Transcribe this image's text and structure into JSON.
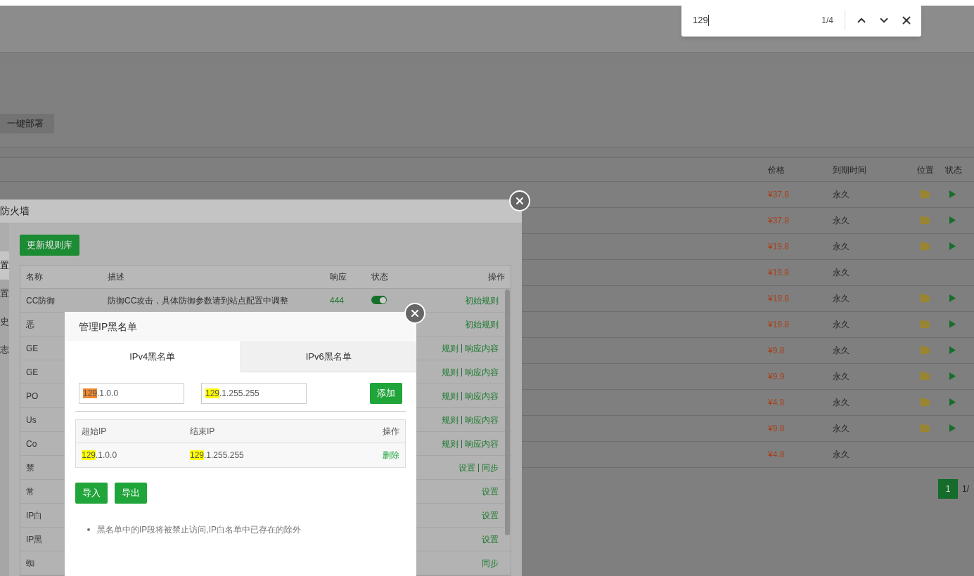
{
  "page": {
    "deploy_button": "一键部署",
    "table": {
      "columns": [
        "价格",
        "到期时间",
        "位置",
        "状态"
      ],
      "rows": [
        {
          "price": "¥37.8",
          "expiry": "永久",
          "folder": true,
          "running": true
        },
        {
          "price": "¥37.8",
          "expiry": "永久",
          "folder": true,
          "running": true
        },
        {
          "price": "¥19.8",
          "expiry": "永久",
          "folder": true,
          "running": true
        },
        {
          "price": "¥19.8",
          "expiry": "永久",
          "folder": false,
          "running": false
        },
        {
          "price": "¥19.8",
          "expiry": "永久",
          "folder": true,
          "running": true
        },
        {
          "price": "¥19.8",
          "expiry": "永久",
          "folder": true,
          "running": true
        },
        {
          "price": "¥9.8",
          "expiry": "永久",
          "folder": true,
          "running": true
        },
        {
          "price": "¥9.9",
          "expiry": "永久",
          "folder": true,
          "running": true
        },
        {
          "price": "¥4.8",
          "expiry": "永久",
          "folder": true,
          "running": true
        },
        {
          "price": "¥9.8",
          "expiry": "永久",
          "folder": true,
          "running": true
        },
        {
          "price": "¥4.8",
          "expiry": "永久",
          "folder": false,
          "running": false
        }
      ]
    },
    "pagination": {
      "pages": [
        {
          "label": "1",
          "selected": true
        }
      ],
      "summary": "1/"
    }
  },
  "firewall_dialog": {
    "title": "防火墙",
    "sidebar": [
      {
        "selected": false
      },
      {
        "label": "置",
        "selected": true
      },
      {
        "label": "置",
        "selected": false
      },
      {
        "label": "史",
        "selected": false
      },
      {
        "label": "志",
        "selected": false
      }
    ],
    "update_button": "更新规则库",
    "columns": [
      "名称",
      "描述",
      "响应",
      "状态",
      "操作"
    ],
    "rows": [
      {
        "name": "CC防御",
        "description": "防御CC攻击，具体防御参数请到站点配置中调整",
        "response": "444",
        "enabled": true,
        "actions": [
          "初始规则"
        ]
      },
      {
        "name": "恶",
        "actions": [
          "初始规则"
        ]
      },
      {
        "name": "GE",
        "actions": [
          "规则",
          "响应内容"
        ]
      },
      {
        "name": "GE",
        "actions": [
          "规则",
          "响应内容"
        ]
      },
      {
        "name": "PO",
        "actions": [
          "规则",
          "响应内容"
        ]
      },
      {
        "name": "Us",
        "actions": [
          "规则",
          "响应内容"
        ]
      },
      {
        "name": "Co",
        "actions": [
          "规则",
          "响应内容"
        ]
      },
      {
        "name": "禁",
        "actions": [
          "设置",
          "同步"
        ]
      },
      {
        "name": "常",
        "actions": [
          "设置"
        ]
      },
      {
        "name": "IP白",
        "actions": [
          "设置"
        ]
      },
      {
        "name": "IP黑",
        "actions": [
          "设置"
        ]
      },
      {
        "name": "蜘",
        "actions": [
          "同步"
        ]
      }
    ]
  },
  "blacklist_dialog": {
    "title": "管理IP黑名单",
    "tabs": [
      {
        "label": "IPv4黑名单",
        "selected": true
      },
      {
        "label": "IPv6黑名单",
        "selected": false
      }
    ],
    "start_field": {
      "match": "129",
      "rest": ".1.0.0",
      "current": true
    },
    "end_field": {
      "match": "129",
      "rest": ".1.255.255",
      "current": false
    },
    "add_button": "添加",
    "columns": [
      "超始IP",
      "结束IP",
      "操作"
    ],
    "rows": [
      {
        "start": {
          "match": "129",
          "rest": ".1.0.0",
          "current": false
        },
        "end": {
          "match": "129",
          "rest": ".1.255.255",
          "current": false
        },
        "action": "删除"
      }
    ],
    "buttons": [
      "导入",
      "导出"
    ],
    "notes": [
      "黑名单中的IP段将被禁止访问,IP白名单中已存在的除外"
    ]
  },
  "find_bar": {
    "query": "129",
    "count": "1/4"
  }
}
